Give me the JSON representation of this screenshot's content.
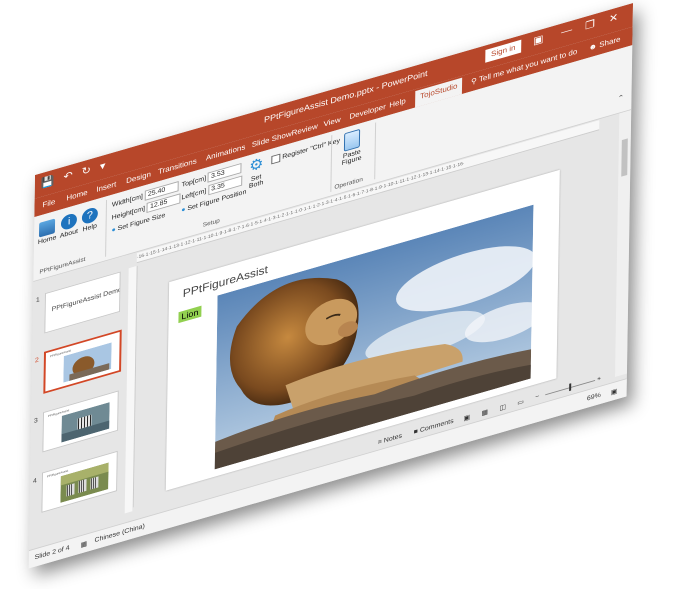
{
  "window": {
    "title": "PPtFigureAssist Demo.pptx - PowerPoint",
    "sign_in": "Sign in",
    "share": "Share"
  },
  "tabs": [
    "File",
    "Home",
    "Insert",
    "Design",
    "Transitions",
    "Animations",
    "Slide Show",
    "Review",
    "View",
    "Developer",
    "Help",
    "TojoStudio"
  ],
  "active_tab": "TojoStudio",
  "tell_me": "Tell me what you want to do",
  "ribbon": {
    "home_label": "Home",
    "about_label": "About",
    "help_label": "Help",
    "width_label": "Width[cm]",
    "width_value": "25.40",
    "height_label": "Height[cm]",
    "height_value": "12.85",
    "top_label": "Top[cm]",
    "top_value": "3.53",
    "left_label": "Left[cm]",
    "left_value": "3.35",
    "set_figure_size": "Set Figure Size",
    "set_figure_position": "Set Figure Position",
    "set_both": "Set Both",
    "register_ctrl_key": "Register \"Ctrl\" Key",
    "paste_figure": "Paste Figure",
    "group_app": "PPtFigureAssist",
    "group_setup": "Setup",
    "group_operation": "Operation"
  },
  "thumbnails": [
    {
      "num": "1",
      "text": "PPtFigureAssist Demo",
      "kind": "title"
    },
    {
      "num": "2",
      "text": "PPtFigureAssist",
      "kind": "lion"
    },
    {
      "num": "3",
      "text": "PPtFigureAssist",
      "kind": "zebra"
    },
    {
      "num": "4",
      "text": "PPtFigureAssist",
      "kind": "zebras"
    }
  ],
  "ruler_text": "·16·1·15·1·14·1·13·1·12·1·11·1·10·1·9·1·8·1·7·1·6·1·5·1·4·1·3·1·2·1·1·1·0·1·1·1·2·1·3·1·4·1·5·1·6·1·7·1·8·1·9·1·10·1·11·1·12·1·13·1·14·1·15·1·16·",
  "slide": {
    "title": "PPtFigureAssist",
    "label": "Lion"
  },
  "status": {
    "slide_info": "Slide 2 of 4",
    "language": "Chinese (China)",
    "notes": "Notes",
    "comments": "Comments",
    "zoom": "69%"
  },
  "colors": {
    "accent": "#b7472a",
    "label_green": "#92d050",
    "selected_thumb": "#d24726"
  }
}
